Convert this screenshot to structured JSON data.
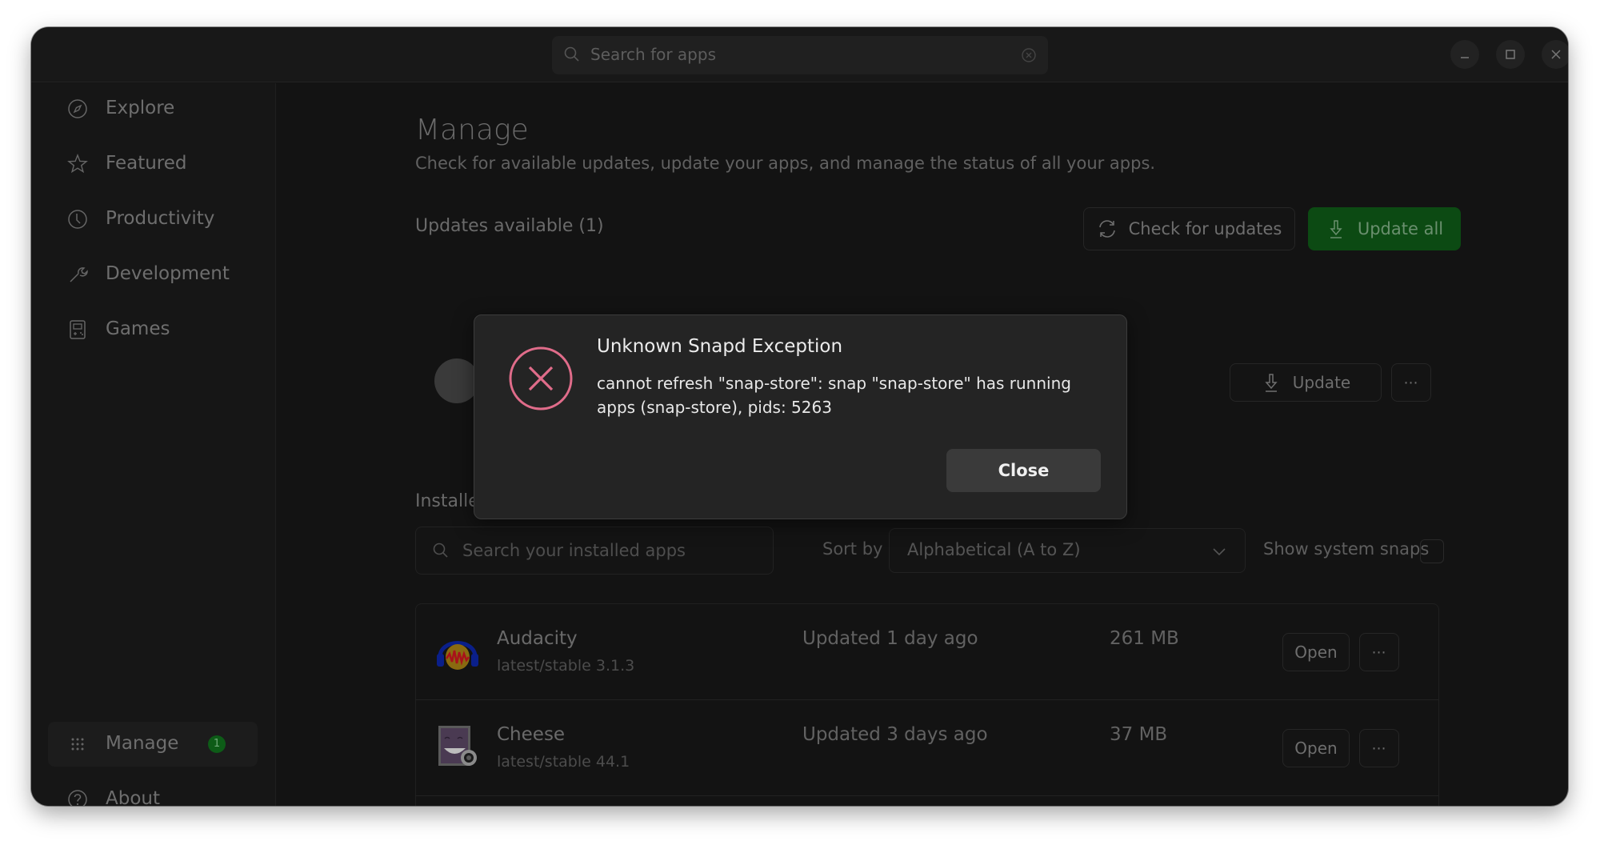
{
  "header": {
    "search_placeholder": "Search for apps",
    "window_controls": [
      "minimize-icon",
      "maximize-icon",
      "close-icon"
    ]
  },
  "sidebar": {
    "items": [
      {
        "label": "Explore",
        "icon": "compass-icon"
      },
      {
        "label": "Featured",
        "icon": "star-icon"
      },
      {
        "label": "Productivity",
        "icon": "clock-icon"
      },
      {
        "label": "Development",
        "icon": "wrench-icon"
      },
      {
        "label": "Games",
        "icon": "gamepad-icon"
      }
    ],
    "bottom_items": [
      {
        "label": "Manage",
        "icon": "grid-icon",
        "badge": "1",
        "active": true
      },
      {
        "label": "About",
        "icon": "help-icon"
      }
    ]
  },
  "main": {
    "title": "Manage",
    "subtitle": "Check for available updates, update your apps, and manage the status of all your apps.",
    "updates": {
      "heading": "Updates available (1)",
      "check_label": "Check for updates",
      "update_all_label": "Update all",
      "row_update_label": "Update",
      "row_more_label": "⋯"
    },
    "installed": {
      "heading": "Installed",
      "search_placeholder": "Search your installed apps",
      "sort_label": "Sort by",
      "sort_value": "Alphabetical (A to Z)",
      "system_snaps_label": "Show system snaps",
      "system_snaps_checked": false,
      "apps": [
        {
          "name": "Audacity",
          "channel": "latest/stable 3.1.3",
          "updated": "Updated 1 day ago",
          "size": "261 MB",
          "open_label": "Open",
          "more_label": "⋯"
        },
        {
          "name": "Cheese",
          "channel": "latest/stable 44.1",
          "updated": "Updated 3 days ago",
          "size": "37 MB",
          "open_label": "Open",
          "more_label": "⋯"
        }
      ]
    }
  },
  "dialog": {
    "title": "Unknown Snapd Exception",
    "message": "cannot refresh \"snap-store\": snap \"snap-store\" has running apps (snap-store), pids: 5263",
    "close_label": "Close",
    "icon": "error-circle-icon",
    "accent_color": "#e06c8a"
  },
  "colors": {
    "update_all_bg": "#0c4a13",
    "badge_bg": "#0d5c17"
  }
}
